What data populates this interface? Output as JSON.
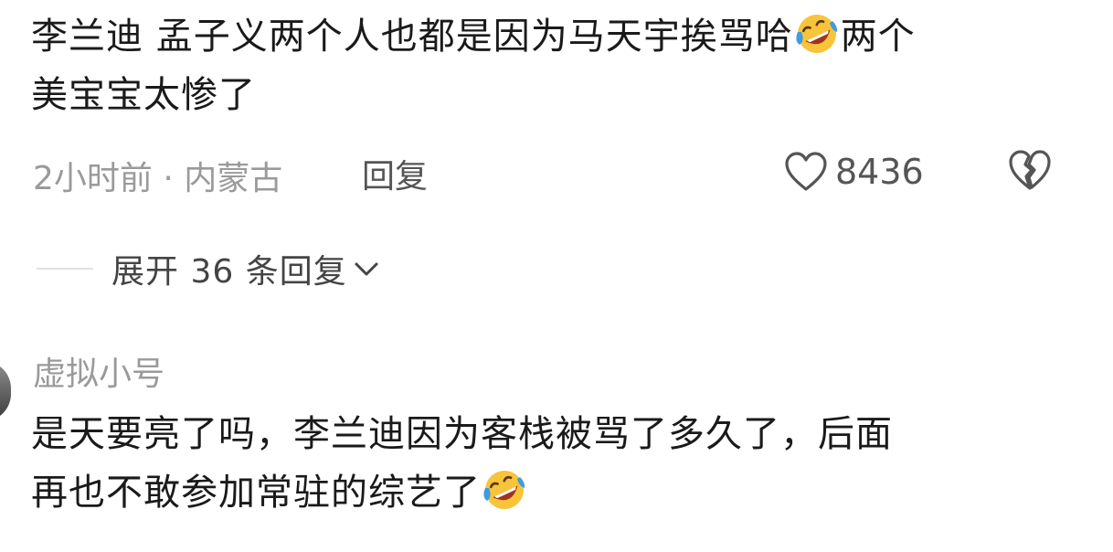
{
  "comment_top": {
    "line1_text": "李兰迪 孟子义两个人也都是因为马天宇挨骂哈",
    "line1_after_emoji": "两个",
    "line2_text": "美宝宝太惨了",
    "emoji": "rofl-emoji"
  },
  "meta": {
    "time_location": "2小时前 · 内蒙古",
    "reply_label": "回复",
    "like_count": "8436",
    "like_icon": "heart-outline-icon",
    "dislike_icon": "broken-heart-icon"
  },
  "expand": {
    "label": "展开 36 条回复",
    "icon": "chevron-down-icon"
  },
  "reply_comment": {
    "username": "虚拟小号",
    "line1_text": "是天要亮了吗，李兰迪因为客栈被骂了多久了，后面",
    "line2_text": "再也不敢参加常驻的综艺了",
    "emoji": "rofl-emoji"
  },
  "colors": {
    "text_primary": "#1a1a1a",
    "text_secondary": "#9a9a9a",
    "text_action": "#555555",
    "emoji_face": "#f7c43a",
    "emoji_tears": "#3d9be0",
    "emoji_mouth": "#a3331c"
  }
}
